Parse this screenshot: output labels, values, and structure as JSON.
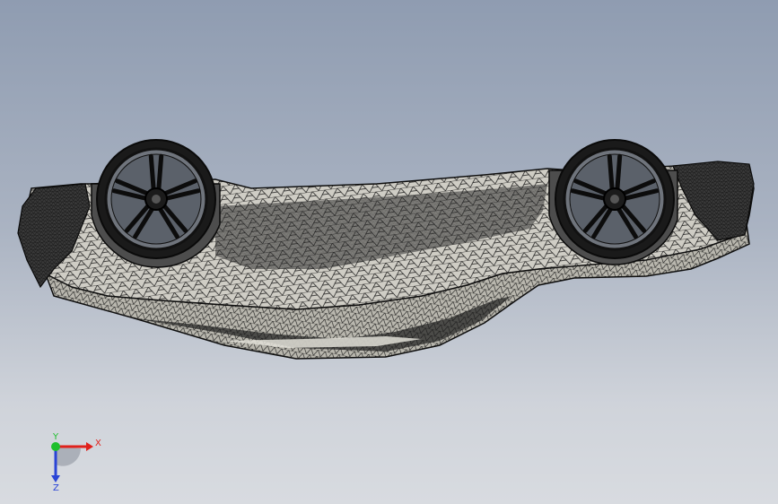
{
  "viewport": {
    "background_top": "#8f9cb1",
    "background_bottom": "#d8dbe0"
  },
  "model": {
    "name": "car-mesh-upside-down",
    "mesh_color": "#1a1a1a",
    "surface_color": "#c9c7bf",
    "display_mode": "wireframe-shaded"
  },
  "triad": {
    "x_label": "X",
    "y_label": "Y",
    "z_label": "Z",
    "x_color": "#e0211c",
    "y_color": "#1fbf2e",
    "z_color": "#2a44d6"
  }
}
